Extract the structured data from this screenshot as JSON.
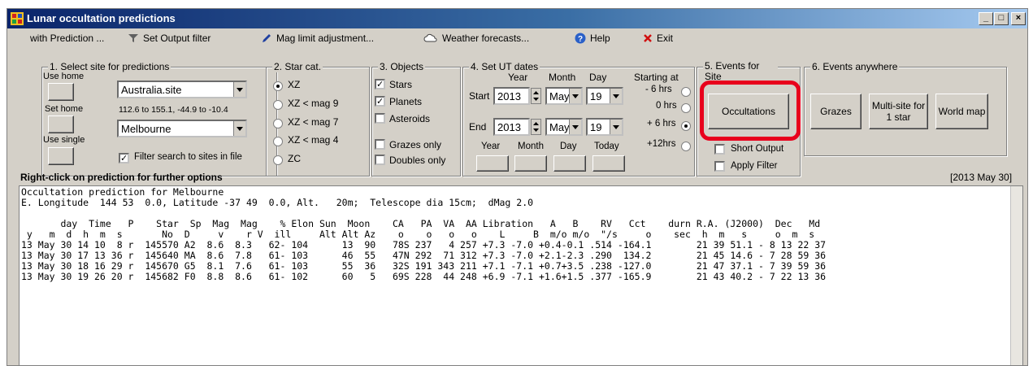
{
  "window": {
    "title": "Lunar occultation predictions",
    "min": "_",
    "max": "□",
    "close": "×"
  },
  "menu": {
    "with_prediction": "with Prediction ...",
    "set_output_filter": "Set Output filter",
    "mag_limit": "Mag limit adjustment...",
    "weather": "Weather forecasts...",
    "help": "Help",
    "exit": "Exit"
  },
  "site": {
    "legend": "1. Select site for predictions",
    "use_home": "Use home",
    "set_home": "Set home",
    "use_single": "Use single",
    "file_value": "Australia.site",
    "range_text": "112.6 to 155.1, -44.9 to -10.4",
    "site_value": "Melbourne",
    "filter_label": "Filter search to sites in file",
    "filter_checked": true
  },
  "starcat": {
    "legend": "2. Star cat.",
    "options": [
      "XZ",
      "XZ  < mag 9",
      "XZ  < mag 7",
      "XZ  < mag 4",
      "ZC"
    ],
    "selected": 0
  },
  "objects": {
    "legend": "3. Objects",
    "stars": "Stars",
    "stars_checked": true,
    "planets": "Planets",
    "planets_checked": true,
    "asteroids": "Asteroids",
    "asteroids_checked": false,
    "grazes_only": "Grazes only",
    "grazes_checked": false,
    "doubles_only": "Doubles only",
    "doubles_checked": false
  },
  "dates": {
    "legend": "4. Set UT dates",
    "year_h": "Year",
    "month_h": "Month",
    "day_h": "Day",
    "starting_h": "Starting at",
    "start_label": "Start",
    "end_label": "End",
    "start_year": "2013",
    "start_month": "May",
    "start_day": "19",
    "end_year": "2013",
    "end_month": "May",
    "end_day": "19",
    "starting_opts": [
      "- 6 hrs",
      "0 hrs",
      "+ 6 hrs",
      "+12hrs"
    ],
    "starting_selected": 2,
    "year_btn": "Year",
    "month_btn": "Month",
    "day_btn": "Day",
    "today_btn": "Today"
  },
  "events_site": {
    "legend": "5. Events for Site",
    "occultations": "Occultations",
    "short_output": "Short Output",
    "apply_filter": "Apply Filter"
  },
  "events_anywhere": {
    "legend": "6. Events anywhere",
    "grazes": "Grazes",
    "multisite": "Multi-site for 1 star",
    "world_map": "World map"
  },
  "hint": "Right-click on prediction for further options",
  "date_stamp": "[2013 May 30]",
  "output": {
    "lines": [
      "Occultation prediction for Melbourne",
      "E. Longitude  144 53  0.0, Latitude -37 49  0.0, Alt.   20m;  Telescope dia 15cm;  dMag 2.0",
      "",
      "       day  Time   P    Star  Sp  Mag  Mag    % Elon Sun  Moon    CA   PA  VA  AA Libration   A   B    RV   Cct    durn R.A. (J2000)  Dec   Md",
      " y   m  d  h  m  s       No  D     v    r V  ill     Alt Alt Az    o    o   o   o    L     B  m/o m/o  \"/s     o    sec  h  m   s     o  m  s   ",
      "13 May 30 14 10  8 r  145570 A2  8.6  8.3   62- 104      13  90   78S 237   4 257 +7.3 -7.0 +0.4-0.1 .514 -164.1        21 39 51.1 - 8 13 22 37",
      "13 May 30 17 13 36 r  145640 MA  8.6  7.8   61- 103      46  55   47N 292  71 312 +7.3 -7.0 +2.1-2.3 .290  134.2        21 45 14.6 - 7 28 59 36",
      "13 May 30 18 16 29 r  145670 G5  8.1  7.6   61- 103      55  36   32S 191 343 211 +7.1 -7.1 +0.7+3.5 .238 -127.0        21 47 37.1 - 7 39 59 36",
      "13 May 30 19 26 20 r  145682 F0  8.8  8.6   61- 102      60   5   69S 228  44 248 +6.9 -7.1 +1.6+1.5 .377 -165.9        21 43 40.2 - 7 22 13 36"
    ]
  },
  "highlight_color": "#e8001c"
}
